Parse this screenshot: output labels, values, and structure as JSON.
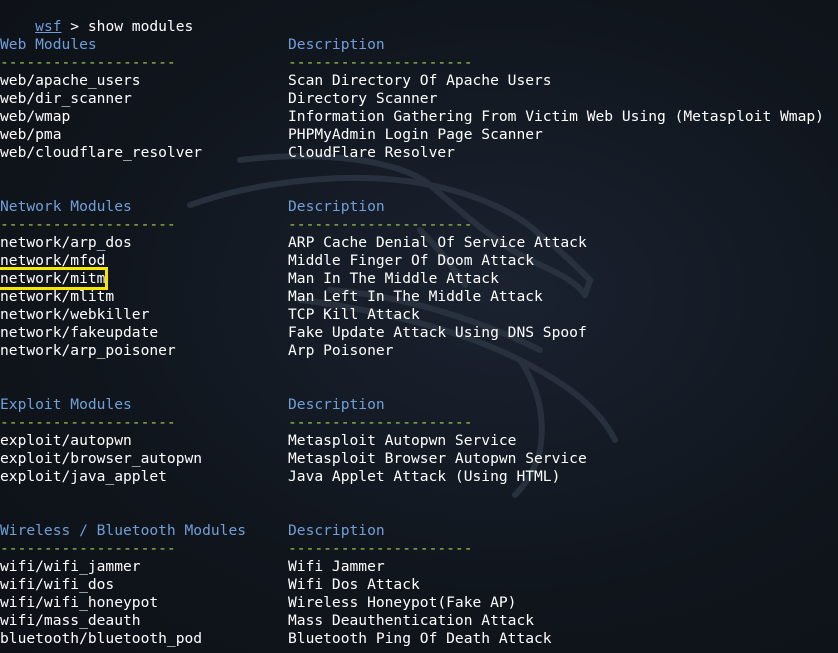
{
  "prompt": {
    "name": "wsf",
    "symbol": " > ",
    "command": "show modules"
  },
  "dash_left": "--------------------",
  "dash_right": "---------------------",
  "sections": [
    {
      "title": "Web Modules",
      "desc_header": "Description",
      "rows": [
        {
          "module": "web/apache_users",
          "desc": "Scan Directory Of Apache Users"
        },
        {
          "module": "web/dir_scanner",
          "desc": "Directory Scanner"
        },
        {
          "module": "web/wmap",
          "desc": "Information Gathering From Victim Web Using (Metasploit Wmap)"
        },
        {
          "module": "web/pma",
          "desc": "PHPMyAdmin Login Page Scanner"
        },
        {
          "module": "web/cloudflare_resolver",
          "desc": "CloudFlare Resolver"
        }
      ]
    },
    {
      "title": "Network Modules",
      "desc_header": "Description",
      "rows": [
        {
          "module": "network/arp_dos",
          "desc": "ARP Cache Denial Of Service Attack"
        },
        {
          "module": "network/mfod",
          "desc": "Middle Finger Of Doom Attack"
        },
        {
          "module": "network/mitm",
          "desc": "Man In The Middle Attack",
          "highlighted": true
        },
        {
          "module": "network/mlitm",
          "desc": "Man Left In The Middle Attack"
        },
        {
          "module": "network/webkiller",
          "desc": "TCP Kill Attack"
        },
        {
          "module": "network/fakeupdate",
          "desc": "Fake Update Attack Using DNS Spoof"
        },
        {
          "module": "network/arp_poisoner",
          "desc": "Arp Poisoner"
        }
      ]
    },
    {
      "title": "Exploit Modules",
      "desc_header": "Description",
      "rows": [
        {
          "module": "exploit/autopwn",
          "desc": "Metasploit Autopwn Service"
        },
        {
          "module": "exploit/browser_autopwn",
          "desc": "Metasploit Browser Autopwn Service"
        },
        {
          "module": "exploit/java_applet",
          "desc": "Java Applet Attack (Using HTML)"
        }
      ]
    },
    {
      "title": "Wireless / Bluetooth Modules",
      "desc_header": "Description",
      "rows": [
        {
          "module": "wifi/wifi_jammer",
          "desc": "Wifi Jammer"
        },
        {
          "module": "wifi/wifi_dos",
          "desc": "Wifi Dos Attack"
        },
        {
          "module": "wifi/wifi_honeypot",
          "desc": "Wireless Honeypot(Fake AP)"
        },
        {
          "module": "wifi/mass_deauth",
          "desc": "Mass Deauthentication Attack"
        },
        {
          "module": "bluetooth/bluetooth_pod",
          "desc": "Bluetooth Ping Of Death Attack"
        }
      ]
    }
  ],
  "colors": {
    "background": "#10151c",
    "heading": "#6f9fd8",
    "dashes": "#a8d14b",
    "text": "#ffffff",
    "highlight_box": "#f6e600"
  },
  "background_icon": "kali-dragon-watermark-icon"
}
